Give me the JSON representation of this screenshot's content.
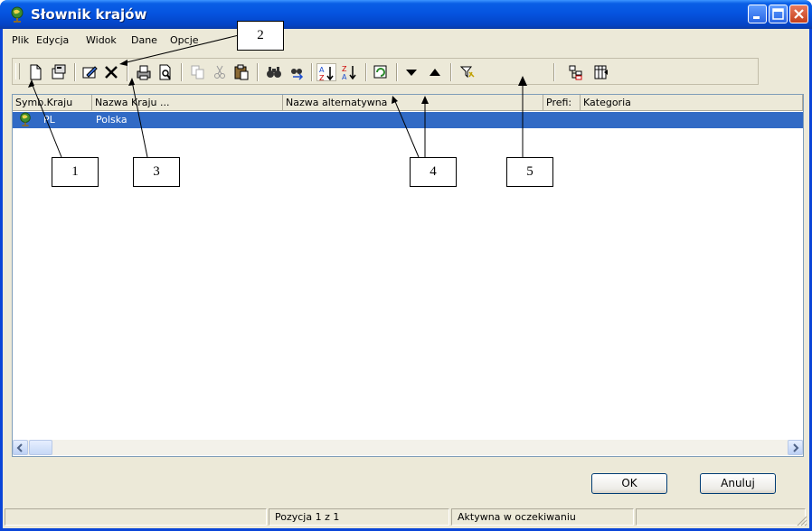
{
  "window": {
    "title": "Słownik krajów",
    "title_icon": "globe-icon"
  },
  "menu": [
    "Plik",
    "Edycja",
    "Widok",
    "Dane",
    "Opcje"
  ],
  "toolbar_icons": [
    "new-icon",
    "properties-icon",
    "edit-icon",
    "delete-icon",
    "print-icon",
    "print-preview-icon",
    "copy-icon",
    "cut-icon",
    "paste-icon",
    "find-icon",
    "find-next-icon",
    "sort-asc-icon",
    "sort-desc-icon",
    "refresh-icon",
    "move-down-icon",
    "move-up-icon",
    "filter-icon",
    "tree-icon",
    "columns-icon"
  ],
  "grid": {
    "columns": [
      "Symb.Kraju",
      "Nazwa Kraju ...",
      "Nazwa alternatywna",
      "Prefi:",
      "Kategoria"
    ],
    "rows": [
      {
        "symbol": "PL",
        "name": "Polska",
        "alt": "",
        "prefix": "",
        "category": ""
      }
    ]
  },
  "buttons": {
    "ok": "OK",
    "cancel": "Anuluj"
  },
  "status": {
    "position": "Pozycja 1 z 1",
    "state": "Aktywna w oczekiwaniu"
  },
  "callouts": [
    "1",
    "2",
    "3",
    "4",
    "5"
  ],
  "colors": {
    "title_blue": "#0554e0",
    "selection": "#316ac5",
    "close_red": "#c6401c"
  }
}
